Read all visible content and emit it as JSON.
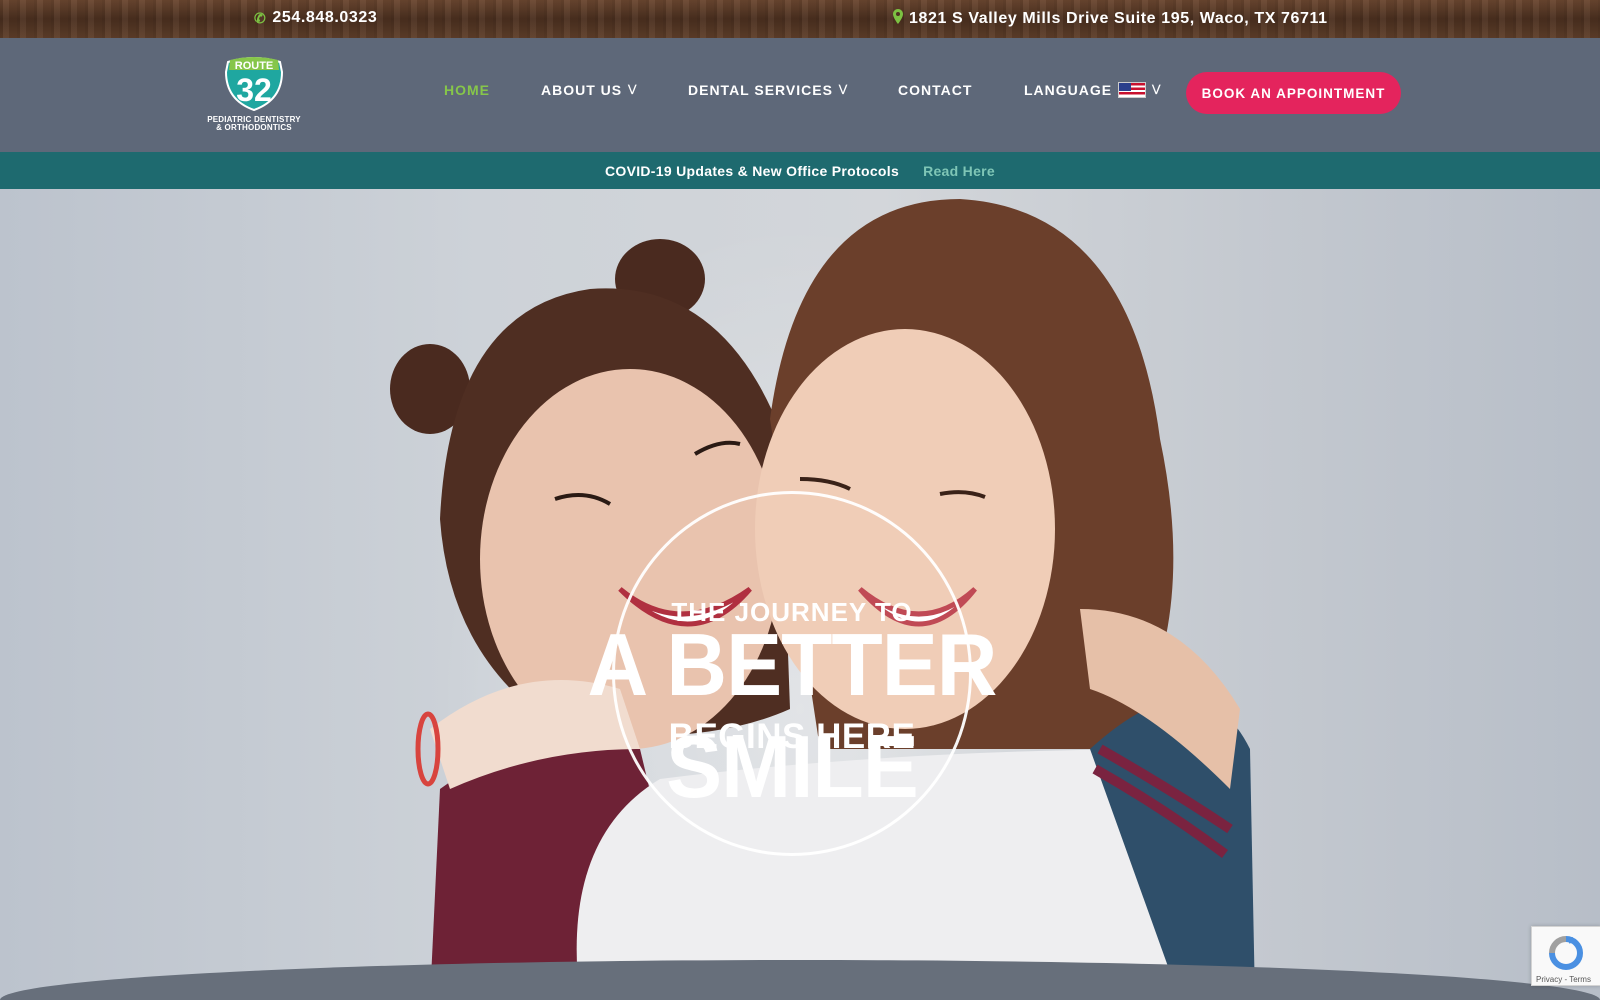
{
  "topbar": {
    "phone": "254.848.0323",
    "address": "1821 S Valley Mills Drive Suite 195, Waco, TX 76711"
  },
  "logo": {
    "route": "ROUTE",
    "number": "32",
    "tagline_line1": "PEDIATRIC DENTISTRY",
    "tagline_line2": "& ORTHODONTICS"
  },
  "nav": {
    "items": [
      {
        "label": "HOME",
        "active": true
      },
      {
        "label": "ABOUT US"
      },
      {
        "label": "DENTAL SERVICES"
      },
      {
        "label": "CONTACT"
      },
      {
        "label": "LANGUAGE"
      }
    ],
    "cta": "BOOK AN APPOINTMENT"
  },
  "banner": {
    "message": "COVID-19 Updates & New Office Protocols",
    "link": "Read Here"
  },
  "hero": {
    "line1": "THE JOURNEY TO",
    "line2": "A BETTER SMILE",
    "line3": "BEGINS HERE"
  },
  "recaptcha": {
    "text": "Privacy - Terms"
  },
  "colors": {
    "nav_bg": "#5e6879",
    "active": "#86c64a",
    "cta": "#e4245d",
    "banner_bg": "#1e6a6f",
    "banner_link": "#7fc6b6"
  }
}
